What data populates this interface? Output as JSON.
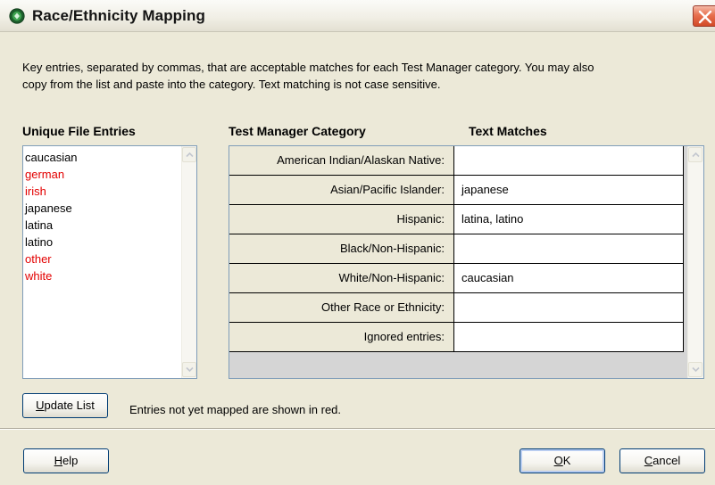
{
  "window": {
    "title": "Race/Ethnicity Mapping",
    "icon": "app-globe-icon",
    "close_icon": "close-icon"
  },
  "instructions": {
    "line1": "Key entries, separated by commas, that are acceptable matches for each Test Manager category.  You may also",
    "line2": "copy from the list and paste into the category.  Text matching is not case sensitive."
  },
  "headers": {
    "unique_entries": "Unique File Entries",
    "category": "Test Manager Category",
    "text_matches": "Text Matches"
  },
  "entries": [
    {
      "text": "caucasian",
      "mapped": true
    },
    {
      "text": "german",
      "mapped": false
    },
    {
      "text": "irish",
      "mapped": false
    },
    {
      "text": "japanese",
      "mapped": true
    },
    {
      "text": "latina",
      "mapped": true
    },
    {
      "text": "latino",
      "mapped": true
    },
    {
      "text": "other",
      "mapped": false
    },
    {
      "text": "white",
      "mapped": false
    }
  ],
  "categories": [
    {
      "label": "American Indian/Alaskan Native:",
      "value": ""
    },
    {
      "label": "Asian/Pacific Islander:",
      "value": "japanese"
    },
    {
      "label": "Hispanic:",
      "value": "latina, latino"
    },
    {
      "label": "Black/Non-Hispanic:",
      "value": ""
    },
    {
      "label": "White/Non-Hispanic:",
      "value": "caucasian"
    },
    {
      "label": "Other Race or Ethnicity:",
      "value": ""
    },
    {
      "label": "Ignored entries:",
      "value": ""
    }
  ],
  "update": {
    "button_label_first": "U",
    "button_label_rest": "pdate List",
    "note": "Entries not yet mapped are shown in red."
  },
  "footer": {
    "help_first": "H",
    "help_rest": "elp",
    "ok_first": "O",
    "ok_rest": "K",
    "cancel_first": "C",
    "cancel_rest": "ancel"
  },
  "colors": {
    "unmapped_text": "#e30000",
    "dialog_background": "#ece9d8",
    "button_border": "#003c74"
  }
}
